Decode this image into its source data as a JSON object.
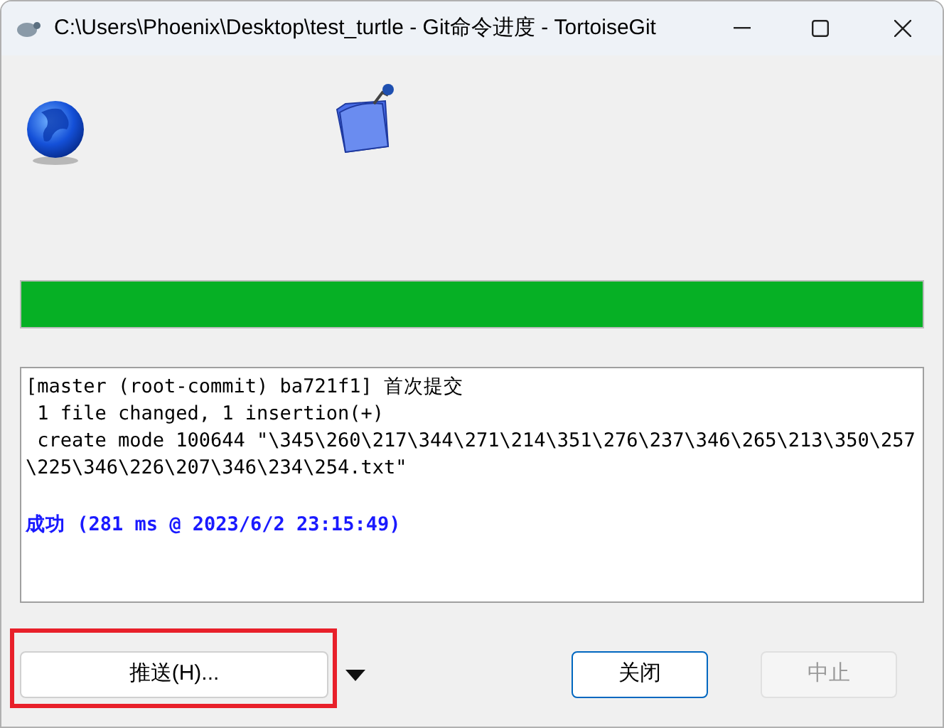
{
  "window": {
    "title": "C:\\Users\\Phoenix\\Desktop\\test_turtle - Git命令进度 - TortoiseGit"
  },
  "progress": {
    "level": 1
  },
  "log": [
    {
      "kind": "normal",
      "text": "[master (root-commit) ba721f1] 首次提交"
    },
    {
      "kind": "normal",
      "text": " 1 file changed, 1 insertion(+)"
    },
    {
      "kind": "normal",
      "text": " create mode 100644 \"\\345\\260\\217\\344\\271\\214\\351\\276\\237\\346\\265\\213\\350\\257"
    },
    {
      "kind": "normal",
      "text": "\\225\\346\\226\\207\\346\\234\\254.txt\""
    },
    {
      "kind": "success",
      "text": "成功 (281 ms @ 2023/6/2 23:15:49)"
    }
  ],
  "buttons": {
    "push": {
      "label": "推送(H)...",
      "highlighted": true
    },
    "close": {
      "label": "关闭"
    },
    "abort": {
      "label": "中止",
      "disabled": true
    }
  }
}
